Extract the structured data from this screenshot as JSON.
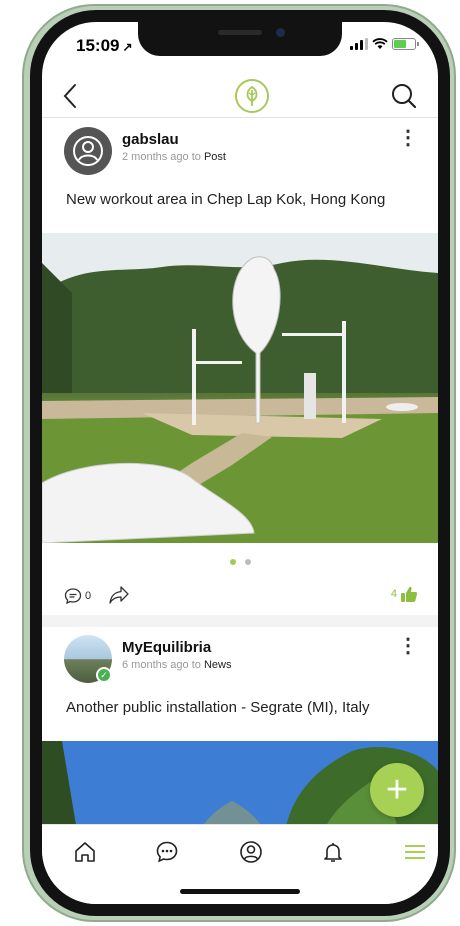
{
  "status_bar": {
    "time": "15:09"
  },
  "nav": {
    "logo_icon": "leaf-icon",
    "accent_color": "#a7c95a"
  },
  "posts": [
    {
      "username": "gabslau",
      "time_ago": "2 months ago to",
      "category": "Post",
      "text": "New workout area in Chep Lap Kok, Hong Kong",
      "comment_count": "0",
      "like_count": "4",
      "carousel_pages": 2,
      "carousel_active": 1
    },
    {
      "username": "MyEquilibria",
      "time_ago": "6 months ago to",
      "category": "News",
      "text": "Another public installation - Segrate (MI), Italy"
    }
  ],
  "fab": {
    "label": "+"
  },
  "tab_bar": {
    "items": [
      "home-icon",
      "chat-icon",
      "profile-icon",
      "bell-icon",
      "menu-icon"
    ],
    "active_color": "#a6d155"
  }
}
